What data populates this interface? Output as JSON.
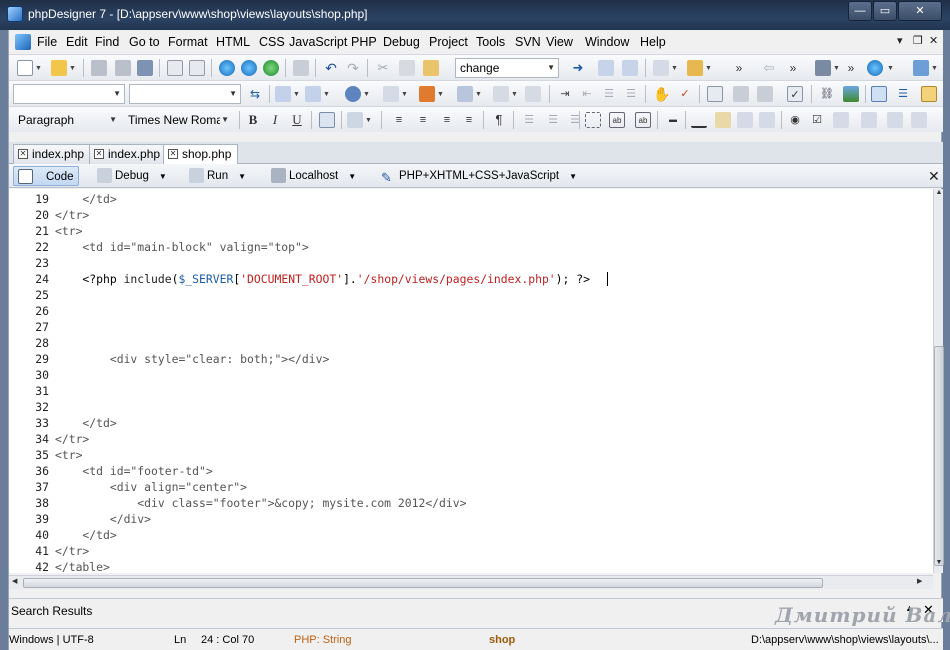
{
  "window": {
    "title": "phpDesigner 7 - [D:\\appserv\\www\\shop\\views\\layouts\\shop.php]",
    "minimize": "—",
    "maximize": "▭",
    "close": "✕"
  },
  "menu": {
    "items": [
      "File",
      "Edit",
      "Find",
      "Go to",
      "Format",
      "HTML",
      "CSS",
      "JavaScript",
      "PHP",
      "Debug",
      "Project",
      "Tools",
      "SVN",
      "View",
      "Window",
      "Help"
    ],
    "controls": [
      "▾",
      "❐",
      "✕"
    ]
  },
  "toolbar1": {
    "change_combo": "change"
  },
  "toolbar3": {
    "paragraph": "Paragraph",
    "font": "Times New Roman",
    "bold": "B",
    "italic": "I",
    "underline": "U"
  },
  "tabs": [
    {
      "label": "index.php"
    },
    {
      "label": "index.php"
    },
    {
      "label": "shop.php",
      "active": true
    }
  ],
  "modebar": {
    "code": "Code",
    "debug": "Debug",
    "run": "Run",
    "server": "Localhost",
    "language": "PHP+XHTML+CSS+JavaScript"
  },
  "editor": {
    "lines": [
      {
        "n": "19",
        "indent": "    ",
        "html": "</td>"
      },
      {
        "n": "20",
        "indent": "",
        "html": "</tr>"
      },
      {
        "n": "21",
        "indent": "",
        "html": "<tr>"
      },
      {
        "n": "22",
        "indent": "    ",
        "html": "<td id=\"main-block\" valign=\"top\">"
      },
      {
        "n": "23",
        "indent": "",
        "html": ""
      },
      {
        "n": "24",
        "indent": "    ",
        "html": "PHPLINE"
      },
      {
        "n": "25",
        "indent": "",
        "html": ""
      },
      {
        "n": "26",
        "indent": "",
        "html": ""
      },
      {
        "n": "27",
        "indent": "",
        "html": ""
      },
      {
        "n": "28",
        "indent": "",
        "html": ""
      },
      {
        "n": "29",
        "indent": "        ",
        "html": "<div style=\"clear: both;\"></div>"
      },
      {
        "n": "30",
        "indent": "",
        "html": ""
      },
      {
        "n": "31",
        "indent": "",
        "html": ""
      },
      {
        "n": "32",
        "indent": "",
        "html": ""
      },
      {
        "n": "33",
        "indent": "    ",
        "html": "</td>"
      },
      {
        "n": "34",
        "indent": "",
        "html": "</tr>"
      },
      {
        "n": "35",
        "indent": "",
        "html": "<tr>"
      },
      {
        "n": "36",
        "indent": "    ",
        "html": "<td id=\"footer-td\">"
      },
      {
        "n": "37",
        "indent": "        ",
        "html": "<div align=\"center\">"
      },
      {
        "n": "38",
        "indent": "            ",
        "html": "<div class=\"footer\">&copy; mysite.com 2012</div>"
      },
      {
        "n": "39",
        "indent": "        ",
        "html": "</div>"
      },
      {
        "n": "40",
        "indent": "    ",
        "html": "</td>"
      },
      {
        "n": "41",
        "indent": "",
        "html": "</tr>"
      },
      {
        "n": "42",
        "indent": "",
        "html": "</table>"
      }
    ],
    "php_line": {
      "open": "<?php ",
      "fn": "include",
      "p1": "(",
      "var": "$_SERVER",
      "b1": "[",
      "key": "'DOCUMENT_ROOT'",
      "b2": "]",
      "dot": ".",
      "path": "'/shop/views/pages/index.php'",
      "tail": "); ?>"
    }
  },
  "search_results": {
    "label": "Search Results"
  },
  "watermark": "Дмитрий Валак",
  "statusbar": {
    "encoding": "Windows | UTF-8",
    "ln_label": "Ln",
    "position": "24 : Col  70",
    "context": "PHP: String",
    "project": "shop",
    "path": "D:\\appserv\\www\\shop\\views\\layouts\\..."
  }
}
